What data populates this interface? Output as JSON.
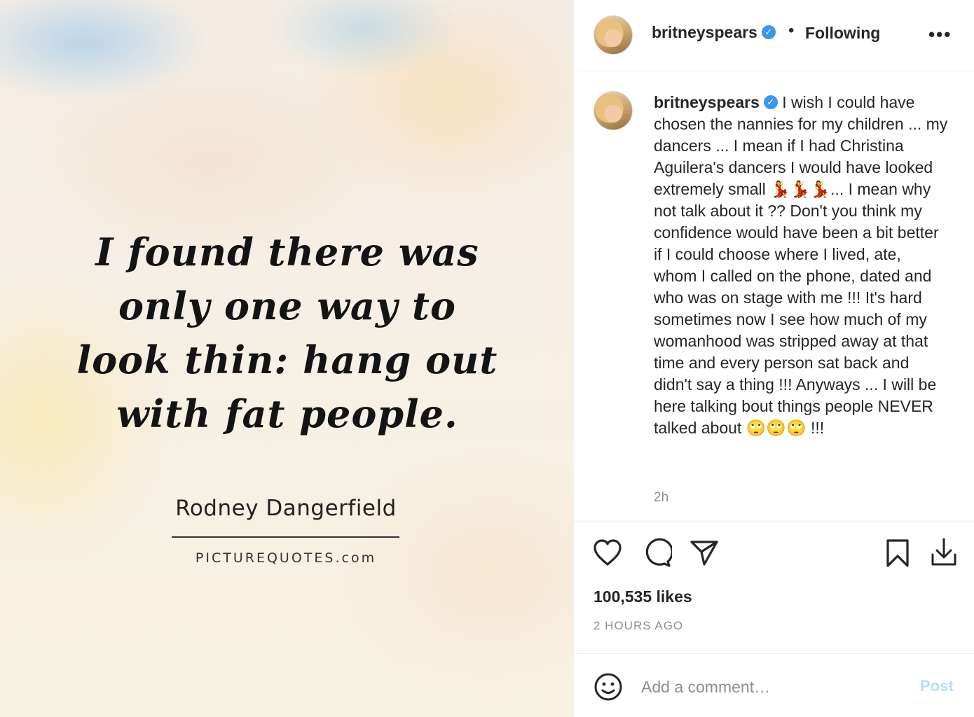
{
  "image": {
    "quote": "I found there was only one way to look thin: hang out with fat people.",
    "author": "Rodney Dangerfield",
    "source": "PICTUREQUOTES.com"
  },
  "header": {
    "username": "britneyspears",
    "verified_icon": "verified-badge-icon",
    "separator": "•",
    "follow_status": "Following",
    "more_icon": "•••"
  },
  "caption": {
    "username": "britneyspears",
    "text": "I wish I could have chosen the nannies for my children ... my dancers ... I mean if I had Christina Aguilera's dancers I would have looked extremely small 💃💃💃... I mean why not talk about it ?? Don't you think my confidence would have been a bit better if I could choose where I lived, ate, whom I called on the phone, dated and who was on stage with me !!! It's hard sometimes now I see how much of my womanhood was stripped away at that time and every person sat back and didn't say a thing !!! Anyways ... I will be here talking bout things people NEVER talked about 🙄🙄🙄 !!!",
    "time": "2h"
  },
  "actions": {
    "likes": "100,535 likes",
    "time_ago": "2 HOURS AGO"
  },
  "comment": {
    "placeholder": "Add a comment…",
    "post_label": "Post"
  }
}
